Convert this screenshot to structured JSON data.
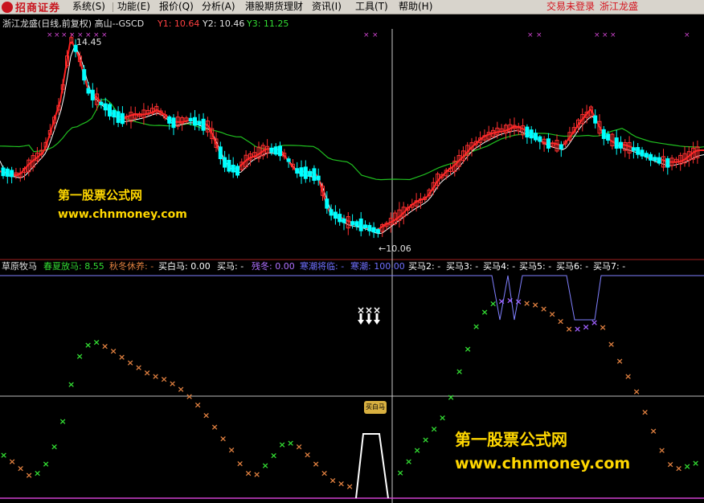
{
  "app": {
    "logo_text": "招商证券",
    "status_left": "交易未登录",
    "status_right": "浙江龙盛"
  },
  "menu": [
    {
      "label": "系统(S)"
    },
    {
      "label": "功能(E)"
    },
    {
      "label": "报价(Q)"
    },
    {
      "label": "分析(A)"
    },
    {
      "label": "港股期货理财"
    },
    {
      "label": "资讯(I)"
    },
    {
      "label": "工具(T)"
    },
    {
      "label": "帮助(H)"
    }
  ],
  "main_panel": {
    "title": "浙江龙盛(日线,前复权) 高山--GSCD",
    "y1_label": "Y1: 10.64",
    "y2_label": "Y2: 10.46",
    "y3_label": "Y3: 11.25",
    "high_label": "14.45",
    "low_label": "←10.06",
    "colors": {
      "up": "#ff3030",
      "down": "#00ffff",
      "ma_short": "#ffffff",
      "ma_long": "#20c020",
      "marker": "#cc44cc"
    }
  },
  "indicator_panel": {
    "name": "草原牧马",
    "items": [
      {
        "label": "春夏放马: 8.55",
        "color": "#33dd33"
      },
      {
        "label": "秋冬休养: -",
        "color": "#e08040"
      },
      {
        "label": "买白马: 0.00",
        "color": "#ffffff"
      },
      {
        "label": "买马: -",
        "color": "#ffffff"
      },
      {
        "label": "残冬: 0.00",
        "color": "#b070ff"
      },
      {
        "label": "寒潮将临: -",
        "color": "#7070ff"
      },
      {
        "label": "寒潮: 100.00",
        "color": "#7070ff"
      },
      {
        "label": "买马2: -",
        "color": "#ffffff"
      },
      {
        "label": "买马3: -",
        "color": "#ffffff"
      },
      {
        "label": "买马4: -",
        "color": "#ffffff"
      },
      {
        "label": "买马5: -",
        "color": "#ffffff"
      },
      {
        "label": "买马6: -",
        "color": "#ffffff"
      },
      {
        "label": "买马7: -",
        "color": "#ffffff"
      }
    ],
    "buy_icon_text": "买白马"
  },
  "watermark": {
    "title": "第一股票公式网",
    "url": "www.chnmoney.com"
  }
}
